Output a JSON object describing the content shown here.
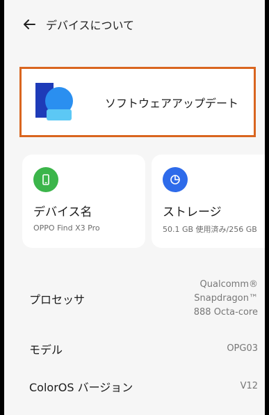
{
  "header": {
    "title": "デバイスについて"
  },
  "software_update": {
    "label": "ソフトウェアアップデート"
  },
  "cards": [
    {
      "title": "デバイス名",
      "subtitle": "OPPO Find X3 Pro",
      "icon": "phone-icon",
      "color": "#3bb54a"
    },
    {
      "title": "ストレージ",
      "subtitle": "50.1 GB 使用済み/256 GB",
      "icon": "pie-chart-icon",
      "color": "#2e6bea"
    }
  ],
  "details": {
    "processor": {
      "label": "プロセッサ",
      "value_lines": [
        "Qualcomm®",
        "Snapdragon™",
        "888 Octa-core"
      ]
    },
    "model": {
      "label": "モデル",
      "value": "OPG03"
    },
    "os": {
      "label": "ColorOS バージョン",
      "value": "V12"
    }
  },
  "colors": {
    "highlight_border": "#d9651f",
    "background": "#f6f6f6"
  }
}
